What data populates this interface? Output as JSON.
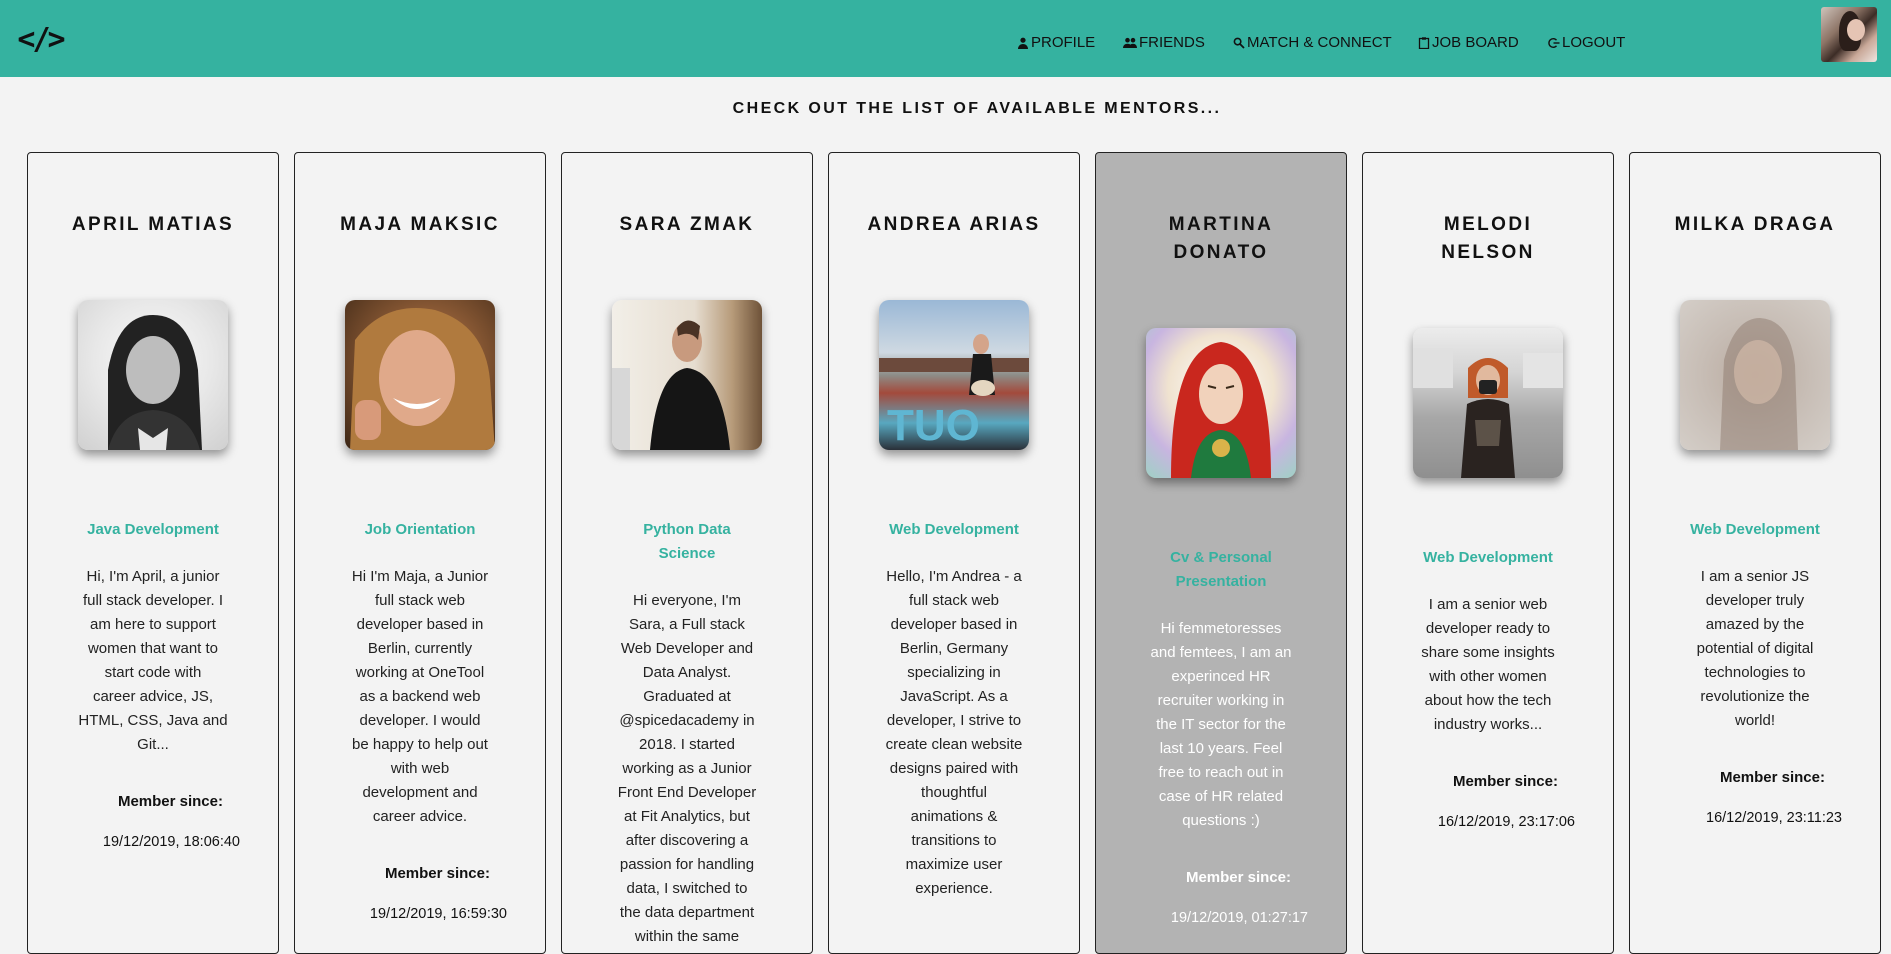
{
  "header": {
    "logo": "</>",
    "nav": [
      {
        "label": "PROFILE",
        "icon": "person-icon"
      },
      {
        "label": "FRIENDS",
        "icon": "people-icon"
      },
      {
        "label": "MATCH & CONNECT",
        "icon": "search-icon"
      },
      {
        "label": "JOB BOARD",
        "icon": "clipboard-icon"
      },
      {
        "label": "LOGOUT",
        "icon": "logout-icon"
      }
    ]
  },
  "heading": "CHECK OUT THE LIST OF AVAILABLE MENTORS...",
  "member_since_label": "Member since:",
  "mentors": [
    {
      "name_lines": [
        "APRIL MATIAS"
      ],
      "skill_lines": [
        "Java Development"
      ],
      "bio_lines": [
        "Hi, I'm April, a junior",
        "full stack developer. I",
        "am here to support",
        "women that want to",
        "start code with",
        "career advice, JS,",
        "HTML, CSS, Java and",
        "Git..."
      ],
      "member_since": "19/12/2019, 18:06:40"
    },
    {
      "name_lines": [
        "MAJA MAKSIC"
      ],
      "skill_lines": [
        "Job Orientation"
      ],
      "bio_lines": [
        "Hi I'm Maja, a Junior",
        "full stack web",
        "developer based in",
        "Berlin, currently",
        "working at OneTool",
        "as a backend web",
        "developer. I would",
        "be happy to help out",
        "with web",
        "development and",
        "career advice."
      ],
      "member_since": "19/12/2019, 16:59:30"
    },
    {
      "name_lines": [
        "SARA ZMAK"
      ],
      "skill_lines": [
        "Python Data",
        "Science"
      ],
      "bio_lines": [
        "Hi everyone, I'm",
        "Sara, a Full stack",
        "Web Developer and",
        "Data Analyst.",
        "Graduated at",
        "@spicedacademy in",
        "2018. I started",
        "working as a Junior",
        "Front End Developer",
        "at Fit Analytics, but",
        "after discovering a",
        "passion for handling",
        "data, I switched to",
        "the data department",
        "within the same"
      ],
      "member_since": ""
    },
    {
      "name_lines": [
        "ANDREA ARIAS"
      ],
      "skill_lines": [
        "Web Development"
      ],
      "bio_lines": [
        "Hello, I'm Andrea - a",
        "full stack web",
        "developer based in",
        "Berlin, Germany",
        "specializing in",
        "JavaScript. As a",
        "developer, I strive to",
        "create clean website",
        "designs paired with",
        "thoughtful",
        "animations &",
        "transitions to",
        "maximize user",
        "experience."
      ],
      "member_since": ""
    },
    {
      "name_lines": [
        "MARTINA",
        "DONATO"
      ],
      "skill_lines": [
        "Cv & Personal",
        "Presentation"
      ],
      "bio_lines": [
        "Hi femmetoresses",
        "and femtees, I am an",
        "experinced HR",
        "recruiter working in",
        "the IT sector for the",
        "last 10 years. Feel",
        "free to reach out in",
        "case of HR related",
        "questions :)"
      ],
      "member_since": "19/12/2019, 01:27:17"
    },
    {
      "name_lines": [
        "MELODI",
        "NELSON"
      ],
      "skill_lines": [
        "Web Development"
      ],
      "bio_lines": [
        "I am a senior web",
        "developer ready to",
        "share some insights",
        "with other women",
        "about how the tech",
        "industry works..."
      ],
      "member_since": "16/12/2019, 23:17:06"
    },
    {
      "name_lines": [
        "MILKA DRAGA"
      ],
      "skill_lines": [
        "Web Development"
      ],
      "bio_lines": [
        "I am a senior JS",
        "developer truly",
        "amazed by the",
        "potential of digital",
        "technologies to",
        "revolutionize the",
        "world!"
      ],
      "member_since": "16/12/2019, 23:11:23"
    }
  ]
}
